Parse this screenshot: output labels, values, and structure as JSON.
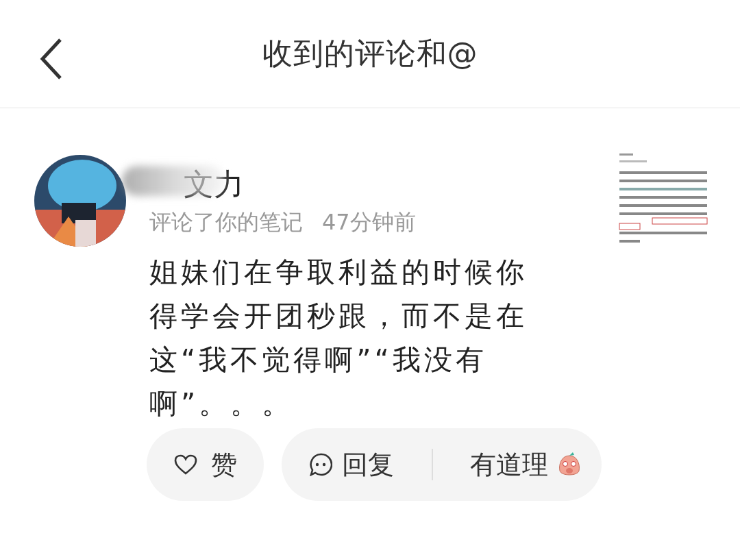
{
  "header": {
    "title": "收到的评论和@"
  },
  "comment": {
    "name": "文力",
    "action": "评论了你的笔记",
    "time": "47分钟前",
    "text": "姐妹们在争取利益的时候你得学会开团秒跟，而不是在这“我不觉得啊”“我没有啊”。。。"
  },
  "actions": [
    {
      "kind": "like",
      "label": "赞"
    },
    {
      "kind": "reply",
      "label": "回复"
    },
    {
      "kind": "quick",
      "label": "有道理"
    }
  ]
}
